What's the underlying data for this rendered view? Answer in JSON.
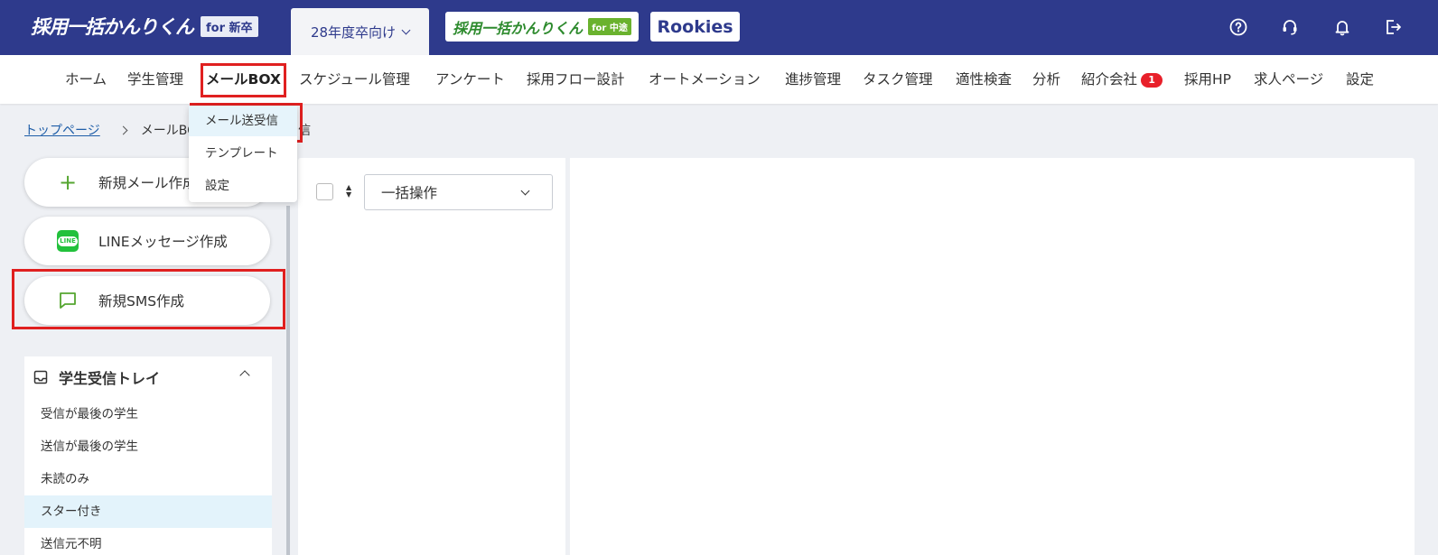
{
  "header": {
    "logo_text": "採用一括かんりくん",
    "logo_tag": "for 新卒",
    "year_select": "28年度卒向け",
    "switch_chuto": "採用一括かんりくん",
    "switch_chuto_tag": "for 中途",
    "switch_rookies": "Rookies"
  },
  "nav": {
    "items": [
      "ホーム",
      "学生管理",
      "メールBOX",
      "スケジュール管理",
      "アンケート",
      "採用フロー設計",
      "オートメーション",
      "進捗管理",
      "タスク管理",
      "適性検査",
      "分析",
      "紹介会社",
      "採用HP",
      "求人ページ",
      "設定"
    ],
    "badge": "1",
    "active": "メールBOX"
  },
  "dropdown": {
    "items": [
      "メール送受信",
      "テンプレート",
      "設定"
    ],
    "selected": "メール送受信"
  },
  "breadcrumb": {
    "home": "トップページ",
    "current_left": "メールBO",
    "current_right": "信"
  },
  "actions": {
    "new_mail": "新規メール作成",
    "line_message": "LINEメッセージ作成",
    "line_icon_text": "LINE",
    "new_sms": "新規SMS作成"
  },
  "inbox": {
    "title": "学生受信トレイ",
    "items": [
      "受信が最後の学生",
      "送信が最後の学生",
      "未読のみ",
      "スター付き",
      "送信元不明"
    ],
    "active": "スター付き"
  },
  "list": {
    "bulk_action": "一括操作"
  },
  "colors": {
    "header_bg": "#2e3a8c",
    "highlight": "#e02020",
    "accent_green": "#55a630",
    "badge_red": "#e8202a"
  }
}
